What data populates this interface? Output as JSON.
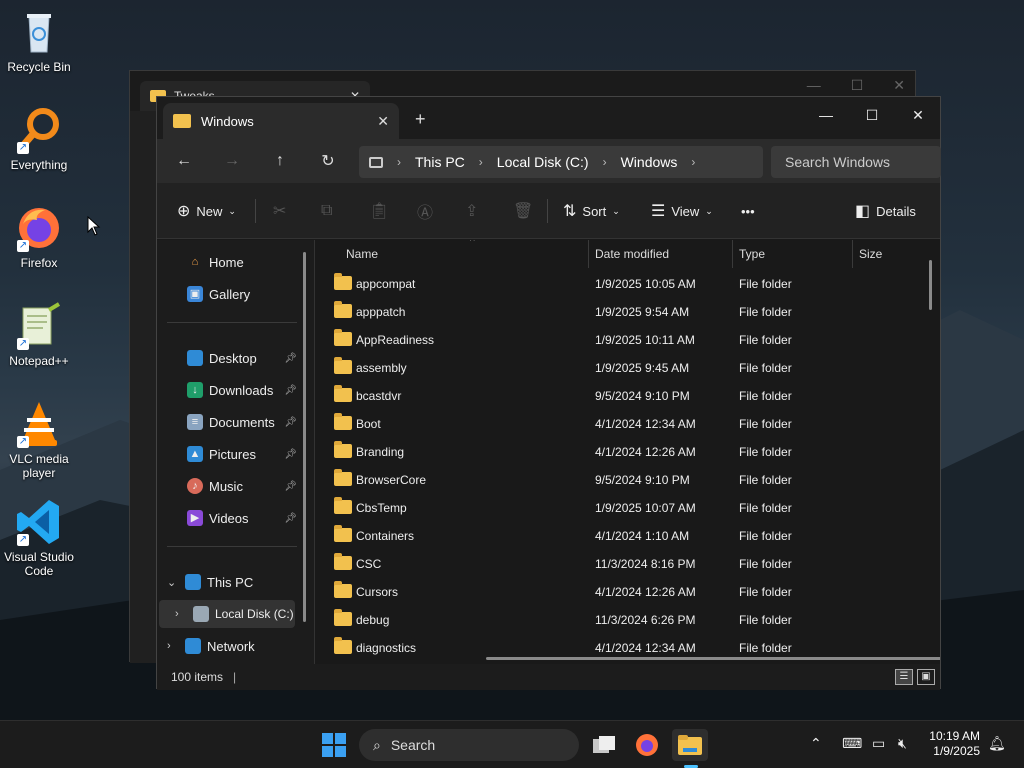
{
  "desktop": {
    "icons": [
      {
        "label": "Recycle Bin",
        "icon": "recycle-bin-icon"
      },
      {
        "label": "Everything",
        "icon": "everything-icon"
      },
      {
        "label": "Firefox",
        "icon": "firefox-icon"
      },
      {
        "label": "Notepad++",
        "icon": "notepad-plus-plus-icon"
      },
      {
        "label": "VLC media player",
        "icon": "vlc-icon"
      },
      {
        "label": "Visual Studio Code",
        "icon": "vscode-icon"
      }
    ]
  },
  "back_window": {
    "tab_title": "Tweaks"
  },
  "window": {
    "tab_title": "Windows",
    "address": {
      "crumbs": [
        "This PC",
        "Local Disk (C:)",
        "Windows"
      ]
    },
    "search_placeholder": "Search Windows",
    "toolbar": {
      "new": "New",
      "sort": "Sort",
      "view": "View",
      "details": "Details",
      "more": "•••"
    },
    "nav": {
      "home": "Home",
      "gallery": "Gallery",
      "desktop": "Desktop",
      "downloads": "Downloads",
      "documents": "Documents",
      "pictures": "Pictures",
      "music": "Music",
      "videos": "Videos",
      "this_pc": "This PC",
      "local_disk": "Local Disk (C:)",
      "network": "Network"
    },
    "columns": {
      "name": "Name",
      "date": "Date modified",
      "type": "Type",
      "size": "Size"
    },
    "files": [
      {
        "name": "appcompat",
        "date": "1/9/2025 10:05 AM",
        "type": "File folder"
      },
      {
        "name": "apppatch",
        "date": "1/9/2025 9:54 AM",
        "type": "File folder"
      },
      {
        "name": "AppReadiness",
        "date": "1/9/2025 10:11 AM",
        "type": "File folder"
      },
      {
        "name": "assembly",
        "date": "1/9/2025 9:45 AM",
        "type": "File folder"
      },
      {
        "name": "bcastdvr",
        "date": "9/5/2024 9:10 PM",
        "type": "File folder"
      },
      {
        "name": "Boot",
        "date": "4/1/2024 12:34 AM",
        "type": "File folder"
      },
      {
        "name": "Branding",
        "date": "4/1/2024 12:26 AM",
        "type": "File folder"
      },
      {
        "name": "BrowserCore",
        "date": "9/5/2024 9:10 PM",
        "type": "File folder"
      },
      {
        "name": "CbsTemp",
        "date": "1/9/2025 10:07 AM",
        "type": "File folder"
      },
      {
        "name": "Containers",
        "date": "4/1/2024 1:10 AM",
        "type": "File folder"
      },
      {
        "name": "CSC",
        "date": "11/3/2024 8:16 PM",
        "type": "File folder"
      },
      {
        "name": "Cursors",
        "date": "4/1/2024 12:26 AM",
        "type": "File folder"
      },
      {
        "name": "debug",
        "date": "11/3/2024 6:26 PM",
        "type": "File folder"
      },
      {
        "name": "diagnostics",
        "date": "4/1/2024 12:34 AM",
        "type": "File folder"
      }
    ],
    "status": "100 items"
  },
  "taskbar": {
    "search_placeholder": "Search",
    "time": "10:19 AM",
    "date": "1/9/2025"
  },
  "colors": {
    "accent": "#0067c0",
    "folder": "#f2c14e",
    "window_bg": "#191919"
  }
}
